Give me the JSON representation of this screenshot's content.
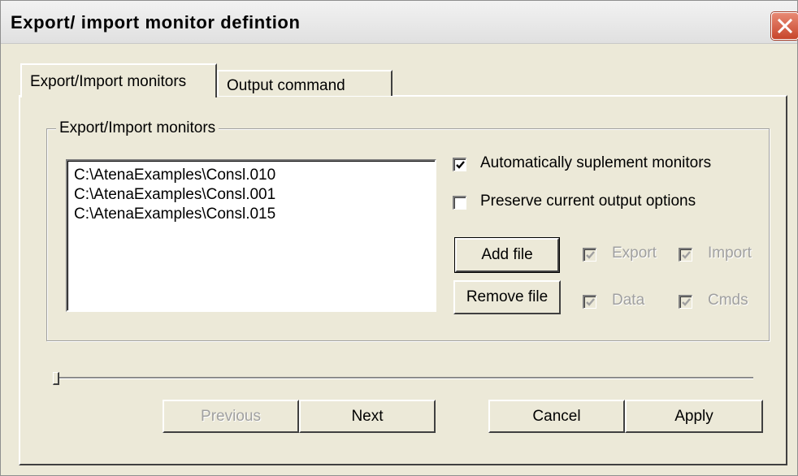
{
  "window": {
    "title": "Export/ import monitor defintion"
  },
  "tabs": [
    {
      "label": "Export/Import monitors",
      "active": true
    },
    {
      "label": "Output command",
      "active": false
    }
  ],
  "group": {
    "label": "Export/Import monitors"
  },
  "files": [
    "C:\\AtenaExamples\\Consl.010",
    "C:\\AtenaExamples\\Consl.001",
    "C:\\AtenaExamples\\Consl.015"
  ],
  "options": {
    "auto_supplement": {
      "label": "Automatically suplement monitors",
      "checked": true
    },
    "preserve_output": {
      "label": "Preserve current output options",
      "checked": false
    }
  },
  "file_buttons": {
    "add": "Add file",
    "remove": "Remove file"
  },
  "flags": {
    "export": {
      "label": "Export",
      "checked": true,
      "enabled": false
    },
    "import": {
      "label": "Import",
      "checked": true,
      "enabled": false
    },
    "data": {
      "label": "Data",
      "checked": true,
      "enabled": false
    },
    "cmds": {
      "label": "Cmds",
      "checked": true,
      "enabled": false
    }
  },
  "slider": {
    "value": 0
  },
  "footer": {
    "previous": "Previous",
    "next": "Next",
    "cancel": "Cancel",
    "apply": "Apply"
  },
  "colors": {
    "face": "#ece9d8",
    "close_button": "#c7452b",
    "disabled_text": "#a0a0a0"
  }
}
